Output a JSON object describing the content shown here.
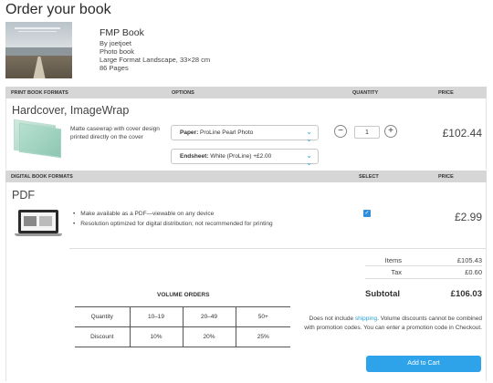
{
  "page": {
    "title": "Order your book"
  },
  "book": {
    "name": "FMP Book",
    "author": "By joetjoet",
    "type": "Photo book",
    "format": "Large Format Landscape, 33×28 cm",
    "pages": "86 Pages"
  },
  "print_section": {
    "header": {
      "formats": "PRINT BOOK FORMATS",
      "options": "OPTIONS",
      "quantity": "QUANTITY",
      "price": "PRICE"
    },
    "item": {
      "title": "Hardcover, ImageWrap",
      "description": "Matte casewrap with cover design printed directly on the cover",
      "paper_label": "Paper:",
      "paper_value": "ProLine Pearl Photo",
      "endsheet_label": "Endsheet:",
      "endsheet_value": "White (ProLine) +£2.00",
      "quantity": "1",
      "minus": "−",
      "plus": "+",
      "price": "£102.44"
    }
  },
  "digital_section": {
    "header": {
      "formats": "DIGITAL BOOK FORMATS",
      "select": "SELECT",
      "price": "PRICE"
    },
    "item": {
      "title": "PDF",
      "bullets": [
        "Make available as a PDF—viewable on any device",
        "Resolution optimized for digital distribution; not recommended for printing"
      ],
      "checked": true,
      "price": "£2.99"
    }
  },
  "summary": {
    "items_label": "Items",
    "items_value": "£105.43",
    "tax_label": "Tax",
    "tax_value": "£0.60",
    "subtotal_label": "Subtotal",
    "subtotal_value": "£106.03"
  },
  "volume_orders": {
    "title": "VOLUME ORDERS",
    "rows": [
      [
        "Quantity",
        "10–19",
        "20–49",
        "50+"
      ],
      [
        "Discount",
        "10%",
        "20%",
        "25%"
      ]
    ]
  },
  "note": {
    "before_link": "Does not include ",
    "link": "shipping",
    "after_link": ". Volume discounts cannot be combined with promotion codes. You can enter a promotion code in Checkout."
  },
  "cart_button": "Add to Cart",
  "colors": {
    "accent": "#2ea3ea",
    "link": "#2aa3d8",
    "header_bar": "#d6d6d6"
  },
  "icons": {
    "select_chevron": "double-chevron-down-icon",
    "check": "check-icon"
  }
}
